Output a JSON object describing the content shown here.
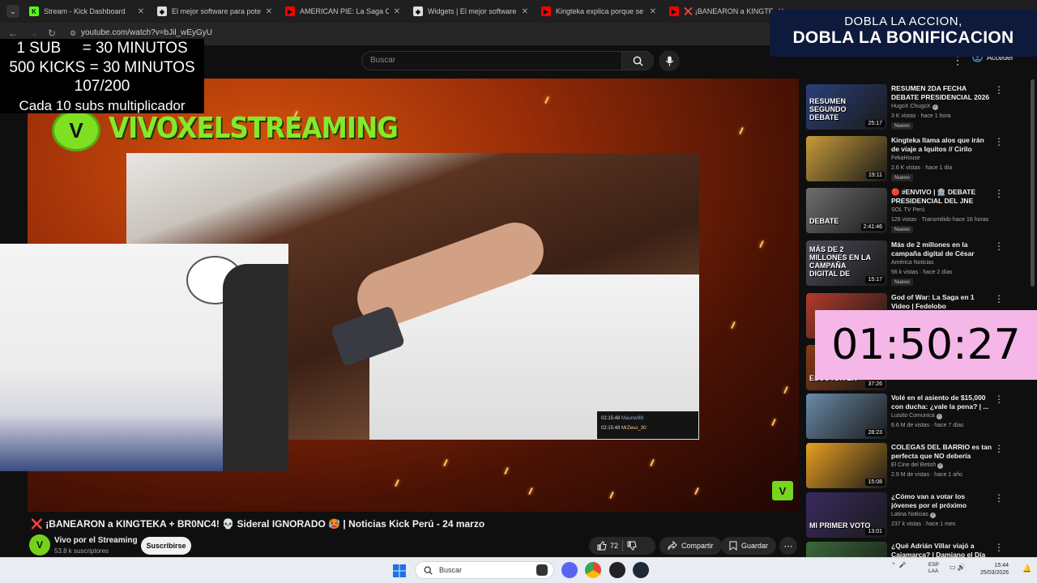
{
  "browser": {
    "tabs": [
      {
        "label": "Stream - Kick Dashboard",
        "favicon": "kick-icon",
        "color": "#53fc18",
        "glyph": "K"
      },
      {
        "label": "El mejor software para potencia",
        "favicon": "streamelements-icon",
        "color": "#dddddd",
        "glyph": "◆"
      },
      {
        "label": "AMERICAN PIE: La Saga Compl",
        "favicon": "youtube-icon",
        "color": "#ff0000",
        "glyph": "▶"
      },
      {
        "label": "Widgets | El mejor software pa",
        "favicon": "streamelements-icon",
        "color": "#dddddd",
        "glyph": "◆"
      },
      {
        "label": "Kingteka explica porque se pel",
        "favicon": "youtube-icon",
        "color": "#ff0000",
        "glyph": "▶"
      },
      {
        "label": "❌ ¡BANEARON a KINGTEKA -",
        "favicon": "youtube-icon",
        "color": "#ff0000",
        "glyph": "▶"
      }
    ],
    "url": "youtube.com/watch?v=bJil_wEyGyU"
  },
  "youtube": {
    "search_placeholder": "Buscar",
    "signin_label": "Acceder",
    "video_title": "❌ ¡BANEARON a KINGTEKA + BR0NC4! 💀 Sideral IGNORADO 🥵 | Noticias Kick Perú - 24 marzo",
    "channel_name": "Vivo por el Streaming",
    "channel_subs": "53.8 k suscriptores",
    "subscribe_label": "Suscribirse",
    "likes": "72",
    "share_label": "Compartir",
    "save_label": "Guardar"
  },
  "stream": {
    "brand_text": "VIVOXELSTREAMING",
    "chat": [
      {
        "time": "02:15:48",
        "user": "Maurov99:"
      },
      {
        "time": "02:15:48",
        "user": "MrZeus_30:"
      }
    ]
  },
  "overlays": {
    "counter_lines": [
      "1 SUB     = 30 MINUTOS",
      "500 KICKS = 30 MINUTOS",
      "107/200",
      "Cada 10 subs multiplicador"
    ],
    "banner_line1": "DOBLA LA ACCION,",
    "banner_line2": "DOBLA LA BONIFICACION",
    "timer": "01:50:27"
  },
  "recommendations": [
    {
      "title": "RESUMEN 2DA FECHA DEBATE PRESIDENCIAL 2026",
      "channel": "HugoX ChugoX",
      "verified": true,
      "meta": "3 K vistas · hace 1 hora",
      "badge": "Nuevo",
      "duration": "25:17",
      "thumb_text": "RESUMEN SEGUNDO DEBATE",
      "thumb_color": "#2a3f7a"
    },
    {
      "title": "Kingteka llama alos que irán de viaje a Iquitos // Cirilo bloquea...",
      "channel": "FekaHouse",
      "verified": false,
      "meta": "2.6 K vistas · hace 1 día",
      "badge": "Nuevo",
      "duration": "19:11",
      "thumb_text": "",
      "thumb_color": "#c89b3a"
    },
    {
      "title": "🔴 #ENVIVO | 🏛️ DEBATE PRESIDENCIAL DEL JNE",
      "channel": "SOL TV Perú",
      "verified": false,
      "meta": "128 vistas · Transmitido hace 16 horas",
      "badge": "Nuevo",
      "duration": "2:41:46",
      "thumb_text": "DEBATE",
      "thumb_color": "#6e6e6e"
    },
    {
      "title": "Más de 2 millones en la campaña digital de César Acu...",
      "channel": "América Noticias",
      "verified": false,
      "meta": "56 k vistas · hace 2 días",
      "badge": "Nuevo",
      "duration": "15:17",
      "thumb_text": "MÁS DE 2 MILLONES EN LA CAMPAÑA DIGITAL DE",
      "thumb_color": "#4a4a58"
    },
    {
      "title": "God of War: La Saga en 1 Video | Fedelobo",
      "channel": "",
      "verified": false,
      "meta": "",
      "badge": "",
      "duration": "",
      "thumb_text": "",
      "thumb_color": "#b33b2a"
    },
    {
      "title": "",
      "channel": "",
      "verified": false,
      "meta": "",
      "badge": "",
      "duration": "37:26",
      "thumb_text": "ESCOTUR EN",
      "thumb_color": "#8a3a14"
    },
    {
      "title": "Volé en el asiento de $15,000 con ducha: ¿vale la pena? | ...",
      "channel": "Luisito Comunica",
      "verified": true,
      "meta": "6.6 M de vistas · hace 7 días",
      "badge": "",
      "duration": "28:23",
      "thumb_text": "",
      "thumb_color": "#6a8aa8"
    },
    {
      "title": "COLEGAS DEL BARRIO es tan perfecta que NO debería existir",
      "channel": "El Cine del Betish",
      "verified": true,
      "meta": "2.9 M de vistas · hace 1 año",
      "badge": "",
      "duration": "15:08",
      "thumb_text": "",
      "thumb_color": "#e8a020"
    },
    {
      "title": "¿Cómo van a votar los jóvenes por el próximo presidente del ...",
      "channel": "Latina Noticias",
      "verified": true,
      "meta": "237 k vistas · hace 1 mes",
      "badge": "",
      "duration": "13:01",
      "thumb_text": "MI PRIMER VOTO",
      "thumb_color": "#3a2a60"
    },
    {
      "title": "¿Qué Adrián Villar viajó a Cajamarca? | Damiano el Día |...",
      "channel": "",
      "verified": false,
      "meta": "",
      "badge": "",
      "duration": "",
      "thumb_text": "",
      "thumb_color": "#3a6a3a"
    }
  ],
  "taskbar": {
    "search_label": "Buscar",
    "lang_line1": "ESP",
    "lang_line2": "LAA",
    "time": "15:44",
    "date": "25/03/2026"
  }
}
